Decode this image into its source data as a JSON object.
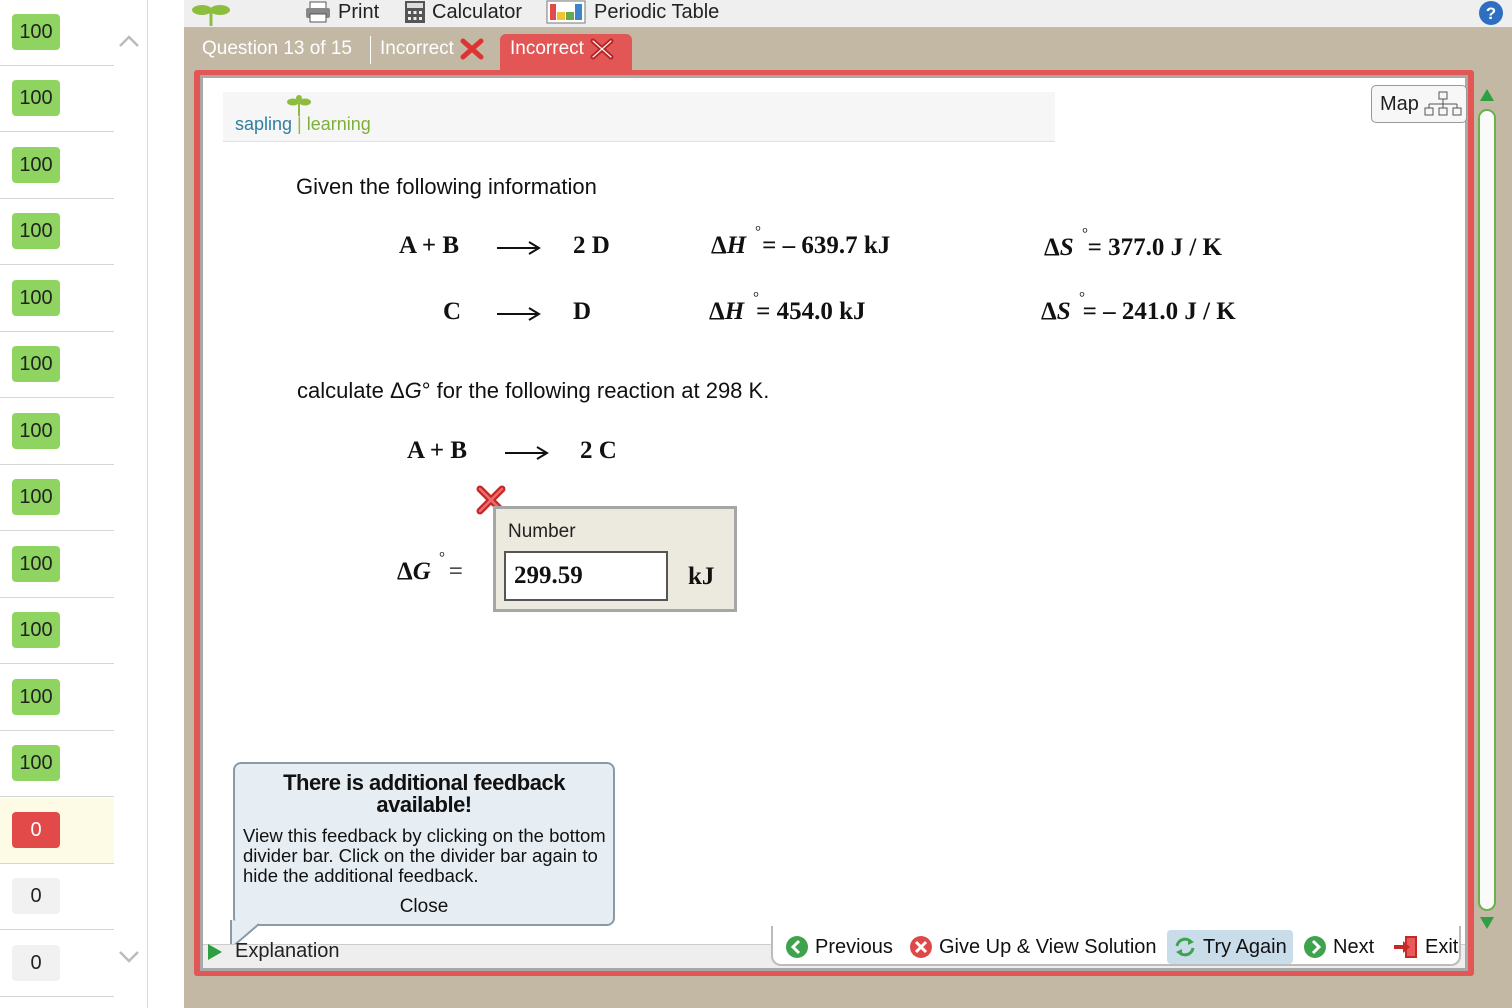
{
  "scores": [
    {
      "value": "100",
      "status": "green"
    },
    {
      "value": "100",
      "status": "green"
    },
    {
      "value": "100",
      "status": "green"
    },
    {
      "value": "100",
      "status": "green"
    },
    {
      "value": "100",
      "status": "green"
    },
    {
      "value": "100",
      "status": "green"
    },
    {
      "value": "100",
      "status": "green"
    },
    {
      "value": "100",
      "status": "green"
    },
    {
      "value": "100",
      "status": "green"
    },
    {
      "value": "100",
      "status": "green"
    },
    {
      "value": "100",
      "status": "green"
    },
    {
      "value": "100",
      "status": "green"
    },
    {
      "value": "0",
      "status": "red"
    },
    {
      "value": "0",
      "status": "gray"
    },
    {
      "value": "0",
      "status": "gray"
    }
  ],
  "toolbar": {
    "print": "Print",
    "calculator": "Calculator",
    "periodic_table": "Periodic Table"
  },
  "tabs": {
    "question_count": "Question 13 of 15",
    "previous_attempt": "Incorrect",
    "current_attempt": "Incorrect"
  },
  "logo": {
    "word1": "sapling",
    "word2": "learning"
  },
  "map_label": "Map",
  "question": {
    "intro": "Given the following information",
    "reactions": [
      {
        "left": "A + B",
        "right": "2 D",
        "dh": "= – 639.7   kJ",
        "ds": "= 377.0   J / K"
      },
      {
        "left": "C",
        "right": "D",
        "dh": "= 454.0   kJ",
        "ds": "=  – 241.0   J / K"
      }
    ],
    "prompt_pre": "calculate Δ",
    "prompt_var": "G",
    "prompt_post": "° for the following reaction at 298 K.",
    "target_left": "A + B",
    "target_right": "2 C",
    "dg_eq": "="
  },
  "answer": {
    "label": "Number",
    "value": "299.59",
    "unit": "kJ"
  },
  "feedback": {
    "title": "There is additional feedback available!",
    "body": "View this feedback by clicking on the bottom divider bar. Click on the divider bar again to hide the additional feedback.",
    "close": "Close"
  },
  "explanation": "Explanation",
  "nav": {
    "previous": "Previous",
    "give_up": "Give Up & View Solution",
    "try_again": "Try Again",
    "next": "Next",
    "exit": "Exit"
  },
  "colors": {
    "incorrect_red": "#e25656",
    "score_green": "#8fd460",
    "accent_green": "#6ab04c"
  }
}
